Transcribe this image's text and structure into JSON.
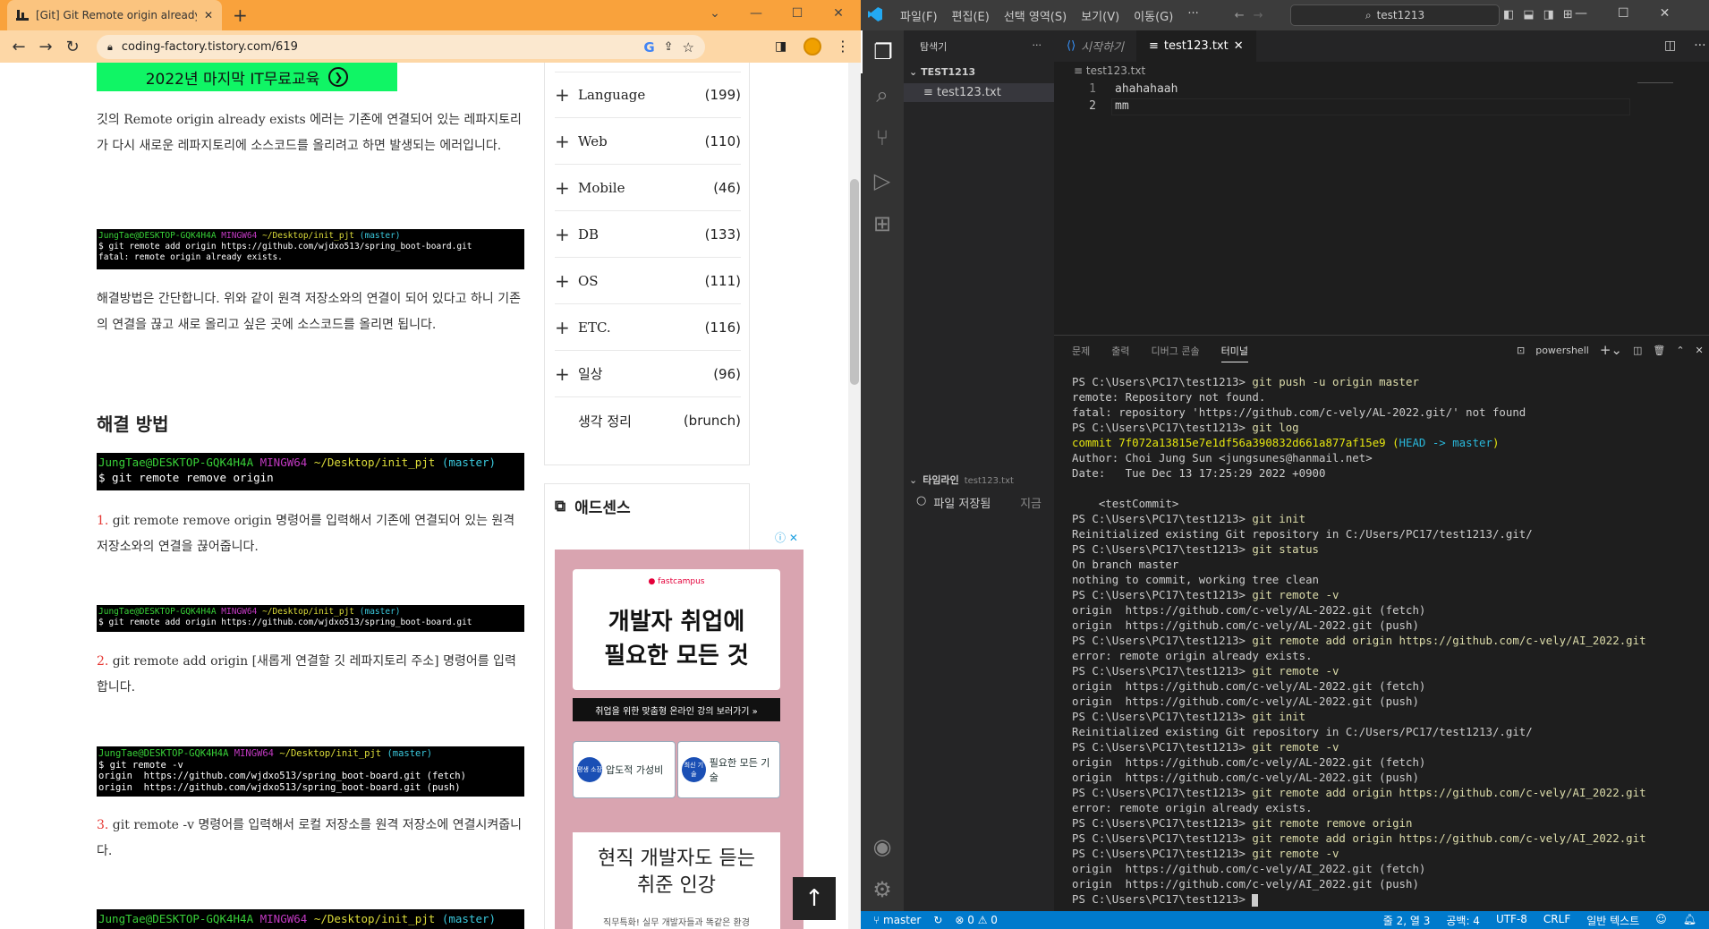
{
  "chrome": {
    "tab_title": "[Git] Git Remote origin already e",
    "new_tab": "+",
    "url": "coding-factory.tistory.com/619"
  },
  "article": {
    "banner": "2022년 마지막 IT무료교육",
    "p1": "깃의 Remote origin already exists 에러는 기존에 연결되어 있는 레파지토리가 다시 새로운 레파지토리에 소스코드를 올리려고 하면 발생되는 에러입니다.",
    "term1": {
      "user": "JungTae@DESKTOP-GQK4H4A",
      "shell": "MINGW64",
      "path": "~/Desktop/init_pjt",
      "branch": "(master)",
      "lines": [
        "$ git remote add origin https://github.com/wjdxo513/spring_boot-board.git",
        "fatal: remote origin already exists."
      ]
    },
    "p2": "해결방법은 간단합니다. 위와 같이 원격 저장소와의 연결이 되어 있다고 하니 기존의 연결을 끊고 새로 올리고 싶은 곳에 소스코드를 올리면 됩니다.",
    "heading": "해결 방법",
    "term2": {
      "lines": [
        "$ git remote remove origin"
      ]
    },
    "s1_num": "1.",
    "s1": " git remote remove origin 명령어를 입력해서 기존에 연결되어 있는 원격 저장소와의 연결을 끊어줍니다.",
    "term3": {
      "lines": [
        "$ git remote add origin https://github.com/wjdxo513/spring_boot-board.git"
      ]
    },
    "s2_num": "2.",
    "s2": " git remote add origin [새롭게 연결할 깃 레파지토리 주소] 명령어를 입력합니다.",
    "term4": {
      "lines": [
        "$ git remote -v",
        "origin  https://github.com/wjdxo513/spring_boot-board.git (fetch)",
        "origin  https://github.com/wjdxo513/spring_boot-board.git (push)"
      ]
    },
    "s3_num": "3.",
    "s3": " git remote -v 명령어를 입력해서 로컬 저장소를 원격 저장소에 연결시켜줍니다."
  },
  "sidebar": {
    "categories": [
      {
        "name": "Language",
        "count": "(199)"
      },
      {
        "name": "Web",
        "count": "(110)"
      },
      {
        "name": "Mobile",
        "count": "(46)"
      },
      {
        "name": "DB",
        "count": "(133)"
      },
      {
        "name": "OS",
        "count": "(111)"
      },
      {
        "name": "ETC.",
        "count": "(116)"
      },
      {
        "name": "일상",
        "count": "(96)"
      },
      {
        "name": "생각 정리",
        "count": "(brunch)"
      }
    ],
    "adsense_title": "애드센스"
  },
  "ad": {
    "logo": "● fastcampus",
    "title_line1": "개발자 취업에",
    "title_line2": "필요한 모든 것",
    "bar": "취업을 위한 맞춤형 온라인 강의 보러가기 »",
    "pill1_badge": "평생 소장",
    "pill1": "압도적 가성비",
    "pill2_badge": "최신 기술",
    "pill2": "필요한 모든 기술",
    "title2_line1": "현직 개발자도 듣는",
    "title2_line2": "취준 인강",
    "sub": "직무특화! 실무 개발자들과 똑같은 환경"
  },
  "vscode": {
    "menus": [
      "파일(F)",
      "편집(E)",
      "선택 영역(S)",
      "보기(V)",
      "이동(G)",
      "···"
    ],
    "command_center": "test1213",
    "explorer_title": "탐색기",
    "folder": "TEST1213",
    "file": "test123.txt",
    "tabs": [
      {
        "label": "시작하기"
      },
      {
        "label": "test123.txt"
      }
    ],
    "breadcrumb": "test123.txt",
    "code_lines": [
      "ahahahaah",
      "mm"
    ],
    "line_numbers": [
      "1",
      "2"
    ],
    "panel_tabs": [
      "문제",
      "출력",
      "디버그 콘솔",
      "터미널"
    ],
    "shell": "powershell",
    "timeline_title": "타임라인",
    "timeline_file": "test123.txt",
    "timeline_item": "파일 저장됨",
    "timeline_time": "지금",
    "status": {
      "branch": "master",
      "errors": "⊗ 0 ⚠ 0",
      "position": "줄 2, 열 3",
      "spaces": "공백: 4",
      "encoding": "UTF-8",
      "eol": "CRLF",
      "language": "일반 텍스트"
    }
  },
  "terminal": [
    {
      "p": "PS C:\\Users\\PC17\\test1213> ",
      "c": "git push -u origin master"
    },
    {
      "t": "remote: Repository not found."
    },
    {
      "t": "fatal: repository 'https://github.com/c-vely/AL-2022.git/' not found"
    },
    {
      "p": "PS C:\\Users\\PC17\\test1213> ",
      "c": "git log"
    },
    {
      "commit": "commit 7f072a13815e7e1df56a390832d661a877af15e9",
      "head": "HEAD -> master"
    },
    {
      "t": "Author: Choi Jung Sun <jungsunes@hanmail.net>"
    },
    {
      "t": "Date:   Tue Dec 13 17:25:29 2022 +0900"
    },
    {
      "t": ""
    },
    {
      "t": "    <testCommit>"
    },
    {
      "p": "PS C:\\Users\\PC17\\test1213> ",
      "c": "git init"
    },
    {
      "t": "Reinitialized existing Git repository in C:/Users/PC17/test1213/.git/"
    },
    {
      "p": "PS C:\\Users\\PC17\\test1213> ",
      "c": "git status"
    },
    {
      "t": "On branch master"
    },
    {
      "t": "nothing to commit, working tree clean"
    },
    {
      "p": "PS C:\\Users\\PC17\\test1213> ",
      "c": "git remote -v"
    },
    {
      "t": "origin  https://github.com/c-vely/AL-2022.git (fetch)"
    },
    {
      "t": "origin  https://github.com/c-vely/AL-2022.git (push)"
    },
    {
      "p": "PS C:\\Users\\PC17\\test1213> ",
      "c": "git remote add origin https://github.com/c-vely/AI_2022.git"
    },
    {
      "t": "error: remote origin already exists."
    },
    {
      "p": "PS C:\\Users\\PC17\\test1213> ",
      "c": "git remote -v"
    },
    {
      "t": "origin  https://github.com/c-vely/AL-2022.git (fetch)"
    },
    {
      "t": "origin  https://github.com/c-vely/AL-2022.git (push)"
    },
    {
      "p": "PS C:\\Users\\PC17\\test1213> ",
      "c": "git init"
    },
    {
      "t": "Reinitialized existing Git repository in C:/Users/PC17/test1213/.git/"
    },
    {
      "p": "PS C:\\Users\\PC17\\test1213> ",
      "c": "git remote -v"
    },
    {
      "t": "origin  https://github.com/c-vely/AL-2022.git (fetch)"
    },
    {
      "t": "origin  https://github.com/c-vely/AL-2022.git (push)"
    },
    {
      "p": "PS C:\\Users\\PC17\\test1213> ",
      "c": "git remote add origin https://github.com/c-vely/AI_2022.git"
    },
    {
      "t": "error: remote origin already exists."
    },
    {
      "p": "PS C:\\Users\\PC17\\test1213> ",
      "c": "git remote remove origin"
    },
    {
      "p": "PS C:\\Users\\PC17\\test1213> ",
      "c": "git remote add origin https://github.com/c-vely/AI_2022.git"
    },
    {
      "p": "PS C:\\Users\\PC17\\test1213> ",
      "c": "git remote -v"
    },
    {
      "t": "origin  https://github.com/c-vely/AI_2022.git (fetch)"
    },
    {
      "t": "origin  https://github.com/c-vely/AI_2022.git (push)"
    },
    {
      "p": "PS C:\\Users\\PC17\\test1213> ",
      "c": ""
    }
  ]
}
